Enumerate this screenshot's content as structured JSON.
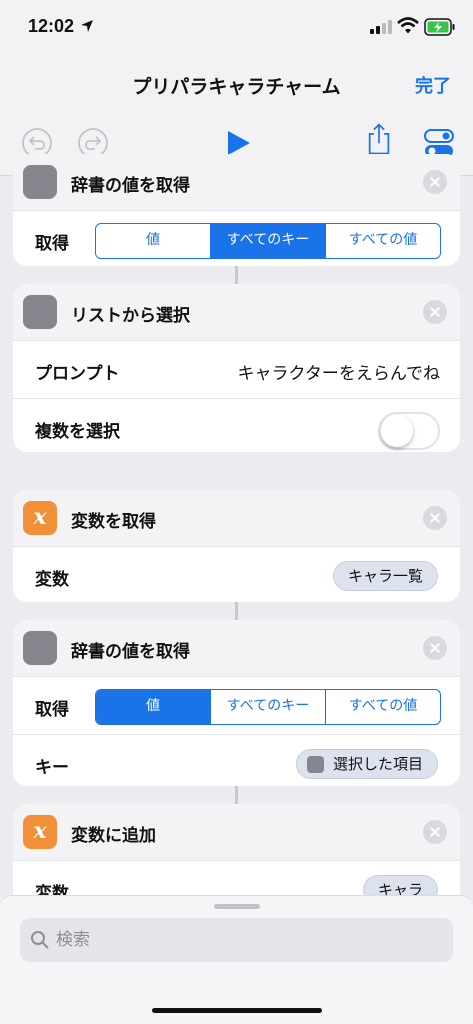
{
  "status": {
    "time": "12:02"
  },
  "nav": {
    "title": "プリパラキャラチャーム",
    "done": "完了"
  },
  "cards": [
    {
      "title": "辞書の値を取得",
      "get_label": "取得",
      "segments": [
        "値",
        "すべてのキー",
        "すべての値"
      ],
      "selected_segment": "すべてのキー"
    },
    {
      "title": "リストから選択",
      "prompt_label": "プロンプト",
      "prompt_value": "キャラクターをえらんでね",
      "multi_label": "複数を選択",
      "multi_enabled": false
    },
    {
      "title": "変数を取得",
      "var_label": "変数",
      "var_value": "キャラ一覧"
    },
    {
      "title": "辞書の値を取得",
      "get_label": "取得",
      "segments": [
        "値",
        "すべてのキー",
        "すべての値"
      ],
      "selected_segment": "値",
      "key_label": "キー",
      "key_value": "選択した項目"
    },
    {
      "title": "変数に追加",
      "var_label": "変数",
      "var_value": "キャラ"
    }
  ],
  "search": {
    "placeholder": "検索"
  },
  "colors": {
    "accent": "#1a73e8",
    "variable_icon": "#f2903a",
    "gear_icon": "#86868e"
  }
}
